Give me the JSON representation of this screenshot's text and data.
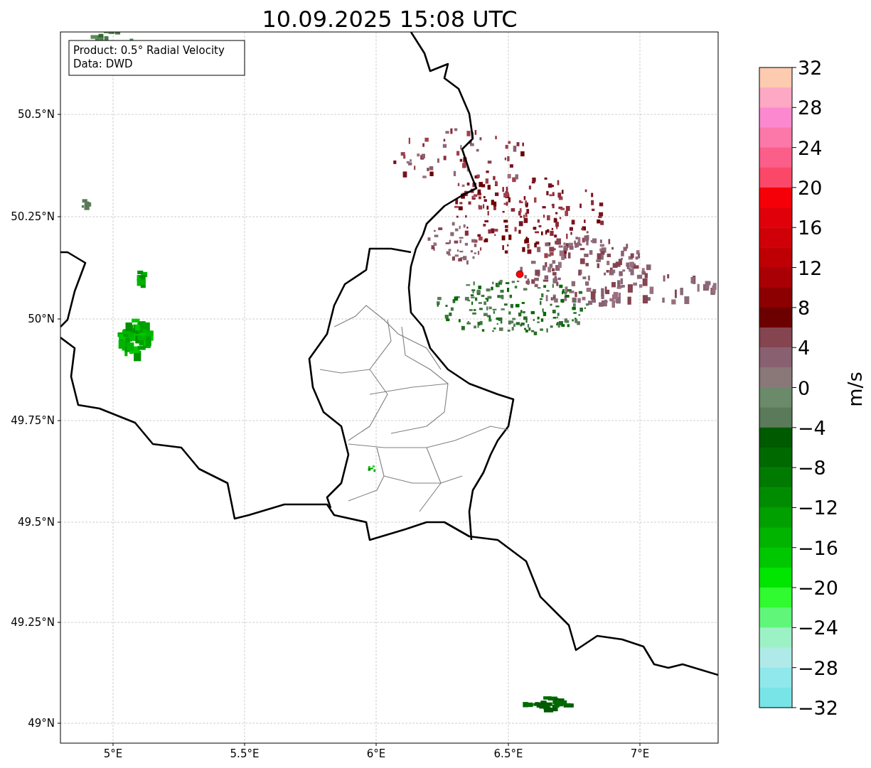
{
  "title": "10.09.2025 15:08 UTC",
  "annotation": [
    "Product: 0.5° Radial Velocity",
    "Data: DWD"
  ],
  "x_ticks": [
    "5°E",
    "5.5°E",
    "6°E",
    "6.5°E",
    "7°E"
  ],
  "y_ticks": [
    "50.5°N",
    "50.25°N",
    "50°N",
    "49.75°N",
    "49.5°N",
    "49.25°N",
    "49°N"
  ],
  "colorbar": {
    "label": "m/s",
    "ticks": [
      "32",
      "28",
      "24",
      "20",
      "16",
      "12",
      "8",
      "4",
      "0",
      "−4",
      "−8",
      "−12",
      "−16",
      "−20",
      "−24",
      "−28",
      "−32"
    ],
    "bands": [
      {
        "color": "#fdcbb0"
      },
      {
        "color": "#fda8c4"
      },
      {
        "color": "#fc88d0"
      },
      {
        "color": "#fc78a8"
      },
      {
        "color": "#fc5e8a"
      },
      {
        "color": "#fc4868"
      },
      {
        "color": "#f50008"
      },
      {
        "color": "#e0000a"
      },
      {
        "color": "#d00008"
      },
      {
        "color": "#be0005"
      },
      {
        "color": "#a80004"
      },
      {
        "color": "#8c0002"
      },
      {
        "color": "#6c0000"
      },
      {
        "color": "#844450"
      },
      {
        "color": "#886070"
      },
      {
        "color": "#8a7878"
      },
      {
        "color": "#6a8a6a"
      },
      {
        "color": "#5a7a5a"
      },
      {
        "color": "#005a00"
      },
      {
        "color": "#006a00"
      },
      {
        "color": "#007a00"
      },
      {
        "color": "#008c00"
      },
      {
        "color": "#00a000"
      },
      {
        "color": "#00b400"
      },
      {
        "color": "#00c800"
      },
      {
        "color": "#00e600"
      },
      {
        "color": "#30fa30"
      },
      {
        "color": "#60f67a"
      },
      {
        "color": "#9cf2c4"
      },
      {
        "color": "#b0eae8"
      },
      {
        "color": "#90e8ec"
      },
      {
        "color": "#78e4e8"
      }
    ]
  }
}
